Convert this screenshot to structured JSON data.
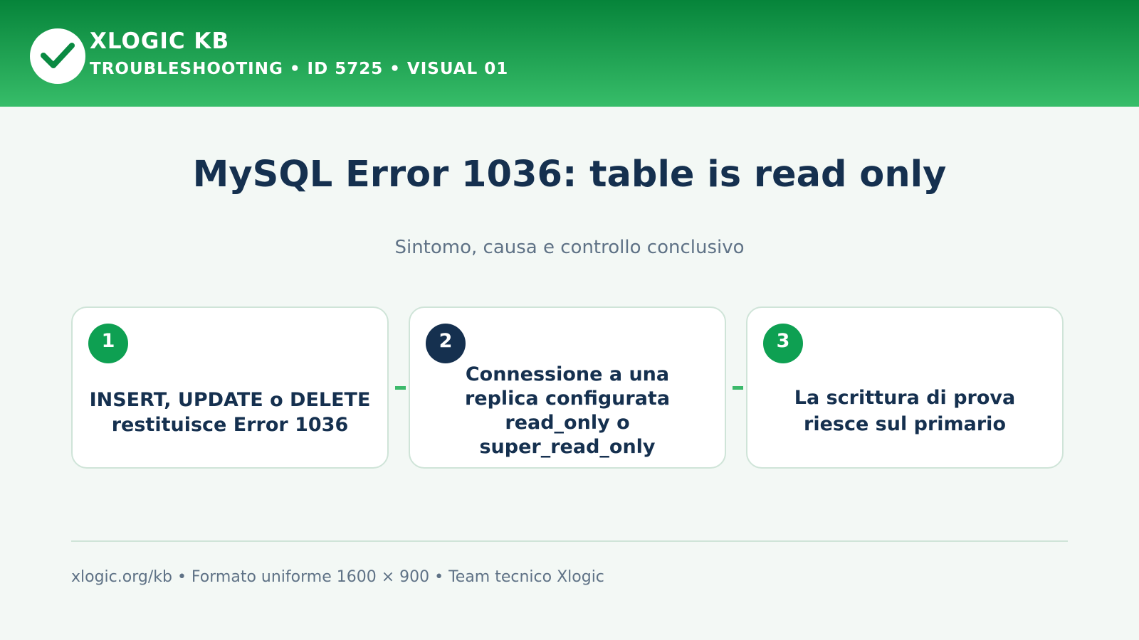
{
  "header": {
    "brand": "XLOGIC KB",
    "subtitle": "TROUBLESHOOTING • ID 5725 • VISUAL 01",
    "logo_icon": "checkmark-icon"
  },
  "main": {
    "title": "MySQL Error 1036: table is read only",
    "subtitle": "Sintomo, causa e controllo conclusivo"
  },
  "steps": [
    {
      "number": "1",
      "color": "#0ea052",
      "lines": [
        "INSERT, UPDATE o DELETE",
        "restituisce Error 1036"
      ]
    },
    {
      "number": "2",
      "color": "#15304f",
      "lines": [
        "Connessione a una",
        "replica configurata",
        "read_only o",
        "super_read_only"
      ]
    },
    {
      "number": "3",
      "color": "#0ea052",
      "lines": [
        "La scrittura di prova",
        "riesce sul primario"
      ]
    }
  ],
  "footer": {
    "text": "xlogic.org/kb • Formato uniforme 1600 × 900 • Team tecnico Xlogic"
  },
  "colors": {
    "header_top": "#06843a",
    "header_bottom": "#37bd69",
    "accent_green": "#0ea052",
    "navy": "#15304f",
    "background": "#f3f8f5"
  }
}
